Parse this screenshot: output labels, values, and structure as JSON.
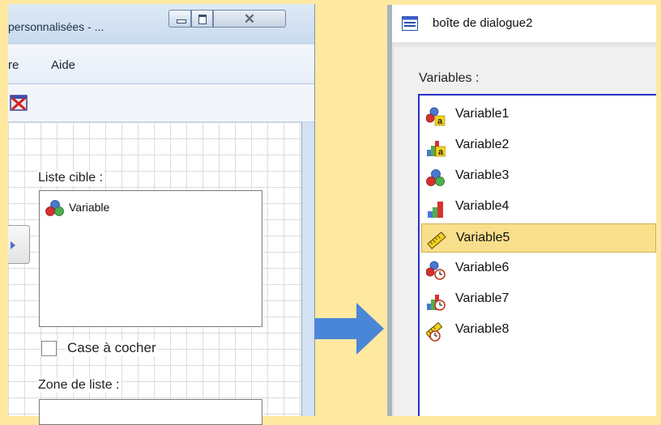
{
  "left_window": {
    "title": "personnalisées - ...",
    "close_glyph": "✕",
    "menu": {
      "fenetre": "re",
      "aide": "Aide"
    },
    "toolbar": {
      "delete_icon": "delete-icon"
    },
    "target_list_label": "Liste cible :",
    "target_list_items": [
      {
        "label": "Variable",
        "icon": "nominal-variable-icon"
      }
    ],
    "checkbox_label": "Case à cocher",
    "listbox_label": "Zone de liste :"
  },
  "arrow": {
    "color": "#4A86D8"
  },
  "right_window": {
    "title": "boîte de dialogue2",
    "variables_label": "Variables :",
    "selected_index": 4,
    "variables": [
      {
        "label": "Variable1",
        "icon": "nominal-string-icon"
      },
      {
        "label": "Variable2",
        "icon": "ordinal-string-icon"
      },
      {
        "label": "Variable3",
        "icon": "nominal-icon"
      },
      {
        "label": "Variable4",
        "icon": "ordinal-icon"
      },
      {
        "label": "Variable5",
        "icon": "scale-icon"
      },
      {
        "label": "Variable6",
        "icon": "nominal-date-icon"
      },
      {
        "label": "Variable7",
        "icon": "ordinal-date-icon"
      },
      {
        "label": "Variable8",
        "icon": "scale-date-icon"
      }
    ]
  },
  "colors": {
    "background": "#FFE8A0",
    "list_border": "#2B2FC9",
    "selection": "#F8DF8C"
  }
}
